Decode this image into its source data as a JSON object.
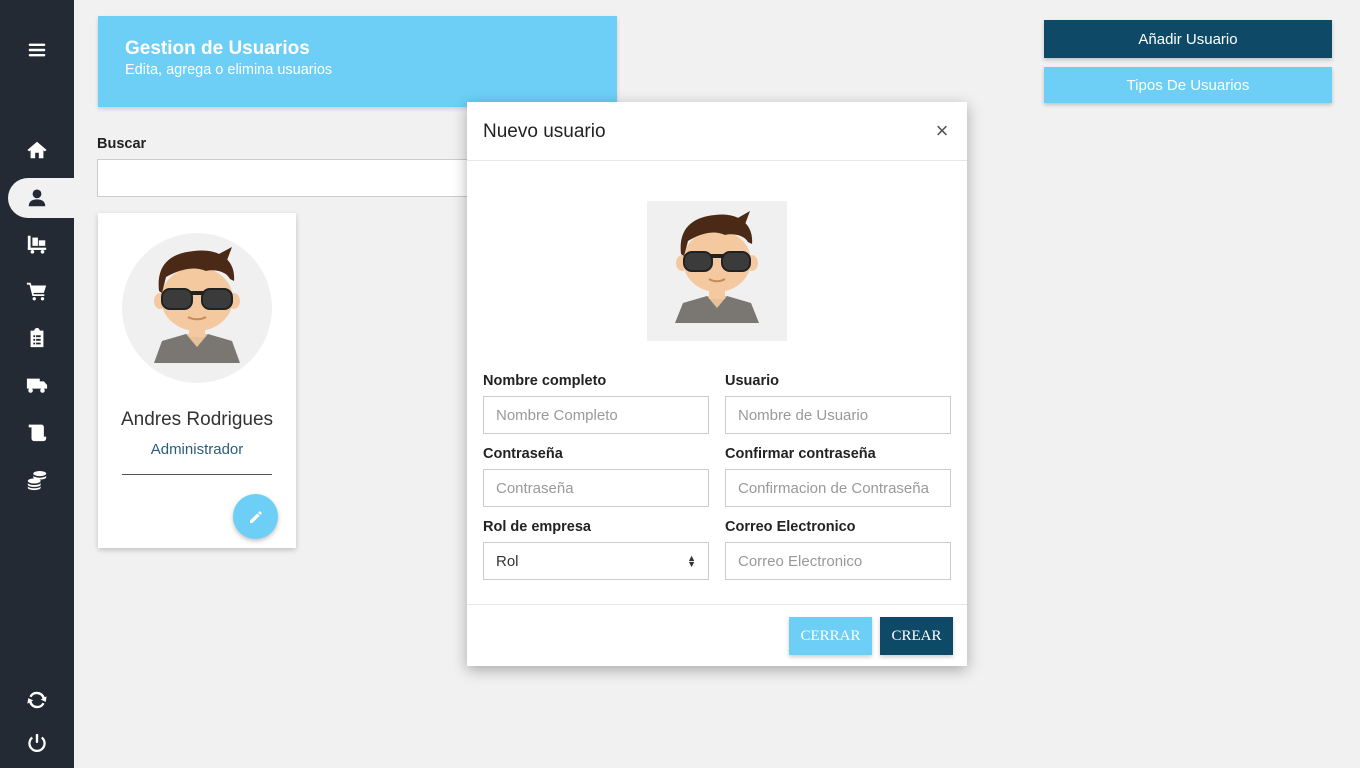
{
  "header": {
    "title": "Gestion de Usuarios",
    "subtitle": "Edita, agrega o elimina usuarios"
  },
  "actions": {
    "add_user": "Añadir Usuario",
    "user_types": "Tipos De Usuarios"
  },
  "search": {
    "label": "Buscar",
    "value": ""
  },
  "sidebar": {
    "items": [
      {
        "icon": "menu-icon"
      },
      {
        "icon": "home-icon"
      },
      {
        "icon": "user-icon",
        "active": true
      },
      {
        "icon": "warehouse-cart-icon"
      },
      {
        "icon": "shopping-cart-icon"
      },
      {
        "icon": "clipboard-icon"
      },
      {
        "icon": "truck-icon"
      },
      {
        "icon": "scroll-icon"
      },
      {
        "icon": "coins-icon"
      },
      {
        "icon": "sync-icon"
      },
      {
        "icon": "power-icon"
      }
    ]
  },
  "user_card": {
    "name": "Andres Rodrigues",
    "role": "Administrador"
  },
  "modal": {
    "title": "Nuevo usuario",
    "close": "×",
    "fields": {
      "full_name": {
        "label": "Nombre completo",
        "placeholder": "Nombre Completo"
      },
      "username": {
        "label": "Usuario",
        "placeholder": "Nombre de Usuario"
      },
      "password": {
        "label": "Contraseña",
        "placeholder": "Contraseña"
      },
      "confirm_password": {
        "label": "Confirmar contraseña",
        "placeholder": "Confirmacion de Contraseña"
      },
      "role": {
        "label": "Rol de empresa",
        "value": "Rol"
      },
      "email": {
        "label": "Correo Electronico",
        "placeholder": "Correo Electronico"
      }
    },
    "close_button": "CERRAR",
    "create_button": "CREAR"
  },
  "colors": {
    "sidebar": "#232a33",
    "accent_light": "#6dcff6",
    "accent_dark": "#0e4a68",
    "background": "#f1f1f1"
  }
}
